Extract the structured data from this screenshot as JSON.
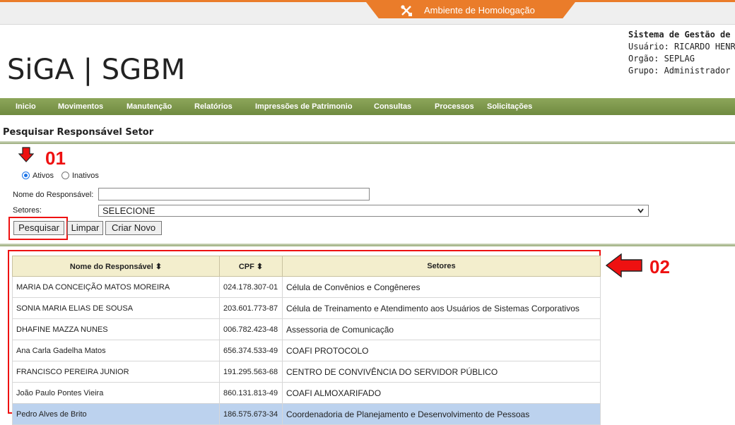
{
  "environment": {
    "label": "Ambiente de Homologação",
    "color": "#ea7c2a"
  },
  "logo": "SiGA | SGBM",
  "user_info": {
    "system": "Sistema de Gestão de A",
    "user": "Usuário: RICARDO HENR",
    "org": "Orgão: SEPLAG",
    "group": "Grupo: Administrador"
  },
  "nav": [
    "Inicio",
    "Movimentos",
    "Manutenção",
    "Relatórios",
    "Impressões de Patrimonio",
    "Consultas",
    "Processos",
    "Solicitações"
  ],
  "page_title": "Pesquisar Responsável Setor",
  "filter": {
    "status_active": "Ativos",
    "status_inactive": "Inativos",
    "name_label": "Nome do Responsável:",
    "name_value": "",
    "sectors_label": "Setores:",
    "sectors_value": "SELECIONE"
  },
  "buttons": {
    "search": "Pesquisar",
    "clear": "Limpar",
    "create": "Criar Novo"
  },
  "annotations": {
    "a1": "01",
    "a2": "02"
  },
  "table": {
    "headers": [
      "Nome do Responsável ⬍",
      "CPF ⬍",
      "Setores"
    ],
    "rows": [
      [
        "MARIA DA CONCEIÇÃO MATOS MOREIRA",
        "024.178.307-01",
        "Célula de Convênios e Congêneres"
      ],
      [
        "SONIA MARIA ELIAS DE SOUSA",
        "203.601.773-87",
        "Célula de Treinamento e Atendimento aos Usuários de Sistemas Corporativos"
      ],
      [
        "DHAFINE MAZZA NUNES",
        "006.782.423-48",
        "Assessoria de Comunicação"
      ],
      [
        "Ana Carla Gadelha Matos",
        "656.374.533-49",
        "COAFI PROTOCOLO"
      ],
      [
        "FRANCISCO PEREIRA JUNIOR",
        "191.295.563-68",
        "CENTRO DE CONVIVÊNCIA DO SERVIDOR PÚBLICO"
      ],
      [
        "João Paulo Pontes Vieira",
        "860.131.813-49",
        "COAFI ALMOXARIFADO"
      ],
      [
        "Pedro Alves de Brito",
        "186.575.673-34",
        "Coordenadoria de Planejamento e Desenvolvimento de Pessoas"
      ]
    ]
  },
  "colors": {
    "nav": "#7a9448",
    "annotation": "#e11111",
    "selected_row": "#bcd2ee",
    "header_row": "#f3eecd"
  }
}
